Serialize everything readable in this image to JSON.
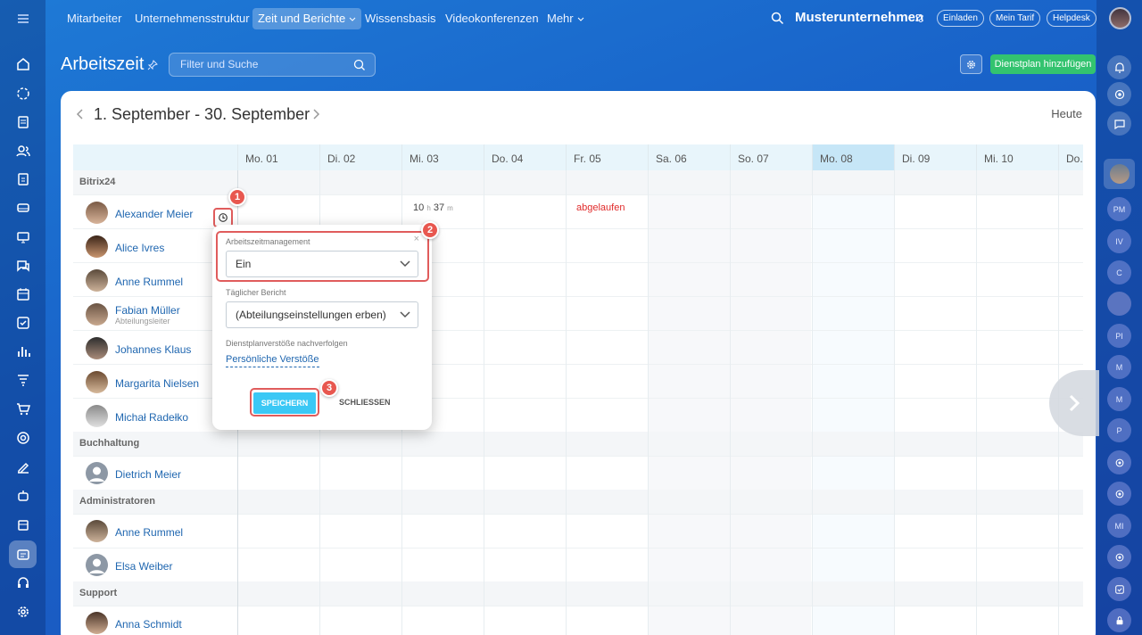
{
  "nav": {
    "items": [
      "Mitarbeiter",
      "Unternehmensstruktur",
      "Zeit und Berichte",
      "Wissensbasis",
      "Videokonferenzen",
      "Mehr"
    ],
    "company": "Musterunternehmen",
    "pills": [
      "Einladen",
      "Mein Tarif",
      "Helpdesk"
    ]
  },
  "page": {
    "title": "Arbeitszeit",
    "filter_placeholder": "Filter und Suche",
    "add_button": "Dienstplan hinzufügen"
  },
  "calendar": {
    "range": "1. September - 30. September",
    "today": "Heute",
    "days": [
      "Mo. 01",
      "Di. 02",
      "Mi. 03",
      "Do. 04",
      "Fr. 05",
      "Sa. 06",
      "So. 07",
      "Mo. 08",
      "Di. 09",
      "Mi. 10",
      "Do."
    ],
    "sections": [
      "Bitrix24",
      "Buchhaltung",
      "Administratoren",
      "Support"
    ],
    "people": [
      {
        "name": "Alexander Meier",
        "sub": ""
      },
      {
        "name": "Alice Ivres",
        "sub": ""
      },
      {
        "name": "Anne Rummel",
        "sub": ""
      },
      {
        "name": "Fabian Müller",
        "sub": "Abteilungsleiter"
      },
      {
        "name": "Johannes Klaus",
        "sub": ""
      },
      {
        "name": "Margarita Nielsen",
        "sub": ""
      },
      {
        "name": "Michał Radełko",
        "sub": ""
      },
      {
        "name": "Dietrich Meier",
        "sub": ""
      },
      {
        "name": "Anne Rummel",
        "sub": ""
      },
      {
        "name": "Elsa Weiber",
        "sub": ""
      },
      {
        "name": "Anna Schmidt",
        "sub": ""
      }
    ],
    "time_h": "10",
    "time_h_unit": "h",
    "time_m": "37",
    "time_m_unit": "m",
    "expired": "abgelaufen"
  },
  "popup": {
    "label1": "Arbeitszeitmanagement",
    "value1": "Ein",
    "label2": "Täglicher Bericht",
    "value2": "(Abteilungseinstellungen erben)",
    "label3": "Dienstplanverstöße nachverfolgen",
    "link": "Persönliche Verstöße",
    "save": "SPEICHERN",
    "close": "SCHLIESSEN",
    "close_x": "×"
  },
  "badges": [
    "1",
    "2",
    "3"
  ],
  "right_avatars": [
    "PM",
    "IV",
    "C",
    "PI",
    "M",
    "M",
    "P",
    "MI"
  ]
}
